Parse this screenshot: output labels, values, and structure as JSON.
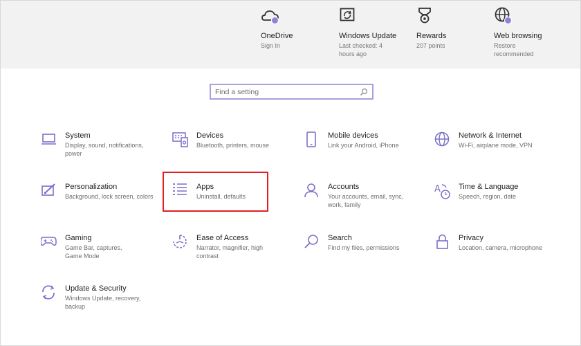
{
  "banner": {
    "items": [
      {
        "title": "OneDrive",
        "sub": "Sign In",
        "icon": "cloud-icon"
      },
      {
        "title": "Windows Update",
        "sub": "Last checked: 4 hours ago",
        "icon": "update-icon"
      },
      {
        "title": "Rewards",
        "sub": "207 points",
        "icon": "medal-icon"
      },
      {
        "title": "Web browsing",
        "sub": "Restore recommended",
        "icon": "globe-icon"
      }
    ]
  },
  "search": {
    "placeholder": "Find a setting"
  },
  "categories": [
    {
      "title": "System",
      "desc": "Display, sound, notifications, power",
      "icon": "laptop-icon"
    },
    {
      "title": "Devices",
      "desc": "Bluetooth, printers, mouse",
      "icon": "keyboard-icon"
    },
    {
      "title": "Mobile devices",
      "desc": "Link your Android, iPhone",
      "icon": "phone-icon"
    },
    {
      "title": "Network & Internet",
      "desc": "Wi-Fi, airplane mode, VPN",
      "icon": "globe-icon"
    },
    {
      "title": "Personalization",
      "desc": "Background, lock screen, colors",
      "icon": "paintbrush-icon"
    },
    {
      "title": "Apps",
      "desc": "Uninstall, defaults",
      "icon": "app-list-icon"
    },
    {
      "title": "Accounts",
      "desc": "Your accounts, email, sync, work, family",
      "icon": "person-icon"
    },
    {
      "title": "Time & Language",
      "desc": "Speech, region, date",
      "icon": "time-language-icon"
    },
    {
      "title": "Gaming",
      "desc": "Game Bar, captures, Game Mode",
      "icon": "gamepad-icon"
    },
    {
      "title": "Ease of Access",
      "desc": "Narrator, magnifier, high contrast",
      "icon": "ease-of-access-icon"
    },
    {
      "title": "Search",
      "desc": "Find my files, permissions",
      "icon": "magnifier-icon"
    },
    {
      "title": "Privacy",
      "desc": "Location, camera, microphone",
      "icon": "lock-icon"
    },
    {
      "title": "Update & Security",
      "desc": "Windows Update, recovery, backup",
      "icon": "sync-icon"
    }
  ],
  "colors": {
    "accent": "#7a6fc9",
    "highlight": "#e01f1f",
    "badge": "#8f83d8"
  }
}
